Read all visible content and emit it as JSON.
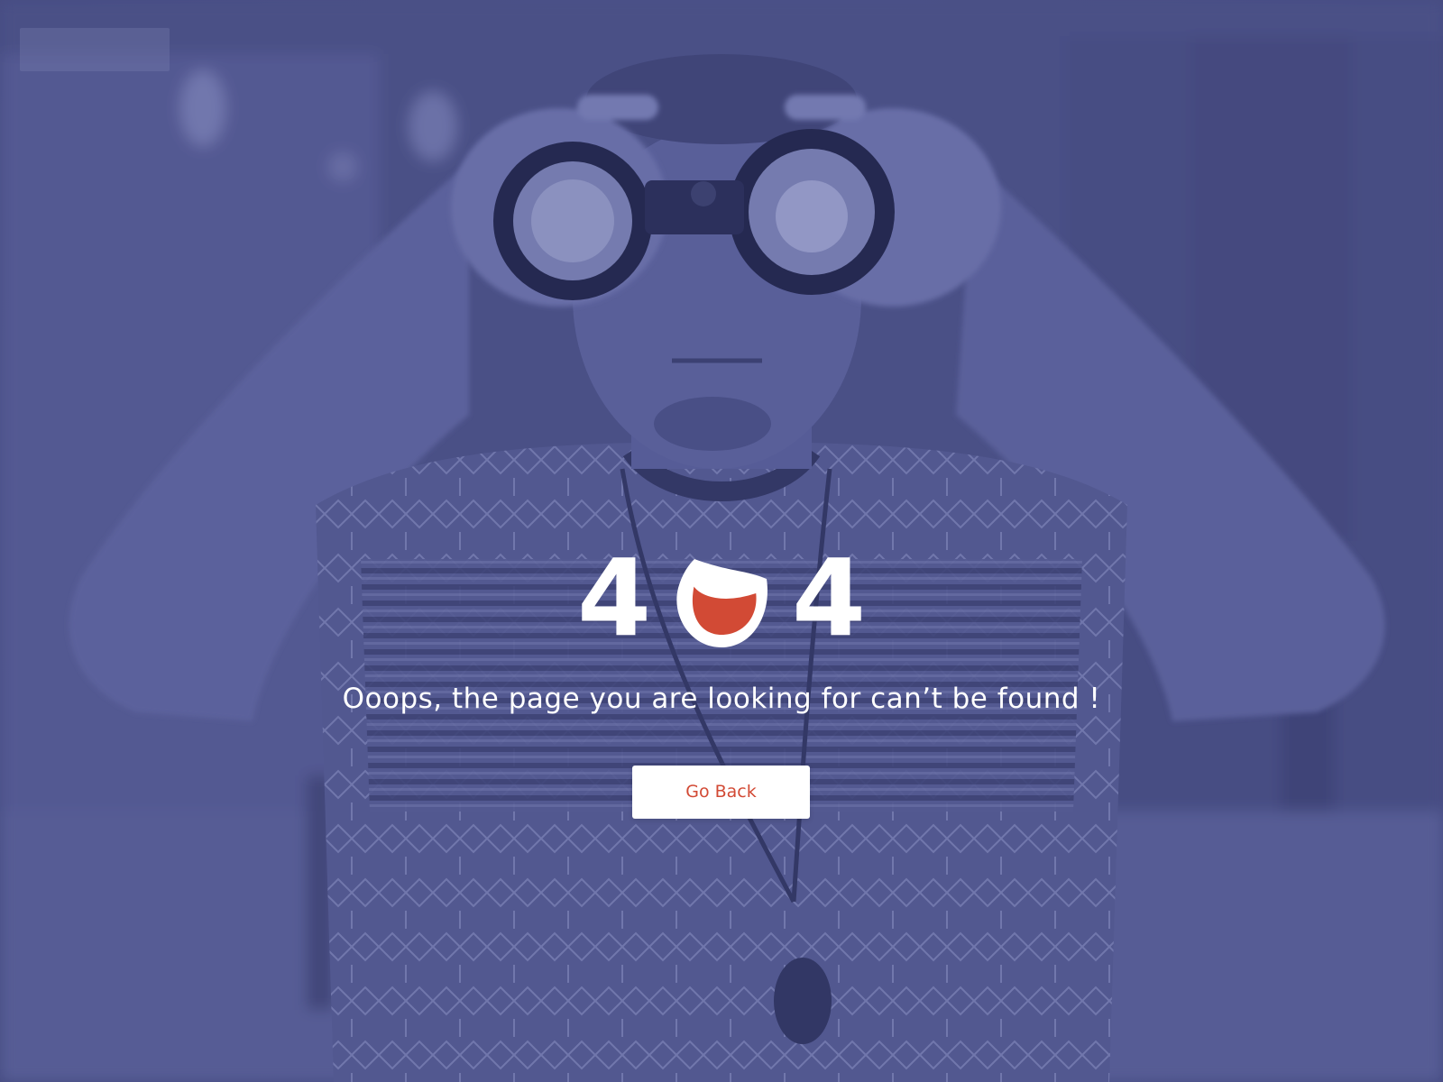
{
  "error": {
    "code_first_digit": "4",
    "code_last_digit": "4",
    "zero_icon": "sad-eye-icon",
    "message": "Ooops, the page you are looking for can’t be found !"
  },
  "actions": {
    "go_back_label": "Go Back"
  },
  "colors": {
    "overlay": "#4e548b",
    "accent": "#d24a35",
    "text": "#ffffff"
  }
}
